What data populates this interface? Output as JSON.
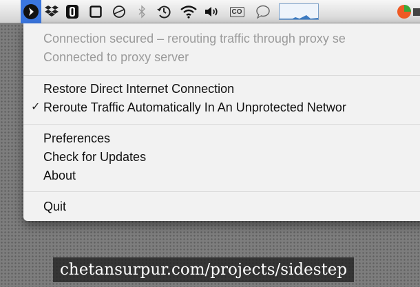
{
  "menubar": {
    "icons": [
      "sidestep-icon",
      "dropbox-icon",
      "1password-icon",
      "window-icon",
      "timer-icon",
      "bluetooth-icon",
      "time-machine-icon",
      "wifi-icon",
      "volume-icon",
      "co-icon",
      "chat-bubble-icon",
      "activity-graph-icon",
      "pie-chart-icon",
      "battery-icon"
    ],
    "co_label": "CO"
  },
  "menu": {
    "status_line1": "Connection secured – rerouting traffic through proxy se",
    "status_line2": "Connected to proxy server",
    "restore": "Restore Direct Internet Connection",
    "reroute": "Reroute Traffic Automatically In An Unprotected Networ",
    "reroute_checkmark": "✓",
    "preferences": "Preferences",
    "check_updates": "Check for Updates",
    "about": "About",
    "quit": "Quit"
  },
  "caption": "chetansurpur.com/projects/sidestep",
  "colors": {
    "selection": "#3a76e0",
    "disabled_text": "#9a9a9a",
    "menu_bg": "#f2f2f2"
  }
}
